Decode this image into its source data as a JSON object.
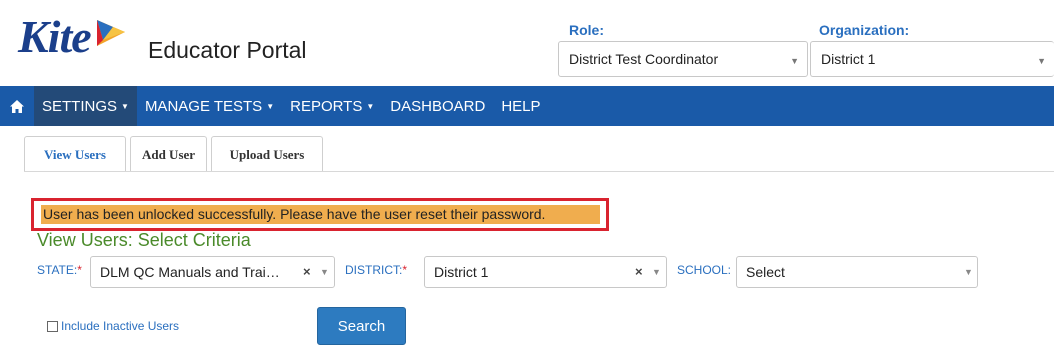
{
  "header": {
    "logo_text": "Kite",
    "portal_title": "Educator Portal",
    "role": {
      "label": "Role:",
      "value": "District Test Coordinator"
    },
    "organization": {
      "label": "Organization:",
      "value": "District 1"
    }
  },
  "nav": {
    "home_icon": "home-icon",
    "items": [
      {
        "label": "SETTINGS",
        "has_caret": true,
        "active": true
      },
      {
        "label": "MANAGE TESTS",
        "has_caret": true
      },
      {
        "label": "REPORTS",
        "has_caret": true
      },
      {
        "label": "DASHBOARD",
        "has_caret": false
      },
      {
        "label": "HELP",
        "has_caret": false
      }
    ],
    "bar_color": "#1a5aa8"
  },
  "tabs": [
    {
      "label": "View Users",
      "active": true
    },
    {
      "label": "Add User"
    },
    {
      "label": "Upload Users"
    }
  ],
  "message": {
    "text": "User has been unlocked successfully. Please have the user reset their password.",
    "highlight_color": "#f0ad4e",
    "border_color": "#d9232f"
  },
  "criteria": {
    "title": "View Users: Select Criteria",
    "state": {
      "label": "STATE:",
      "required": "*",
      "value": "DLM QC Manuals and Trai…"
    },
    "district": {
      "label": "DISTRICT:",
      "required": "*",
      "value": "District 1"
    },
    "school": {
      "label": "SCHOOL:",
      "value": "Select"
    }
  },
  "include_inactive_label": "Include Inactive Users",
  "search_label": "Search"
}
